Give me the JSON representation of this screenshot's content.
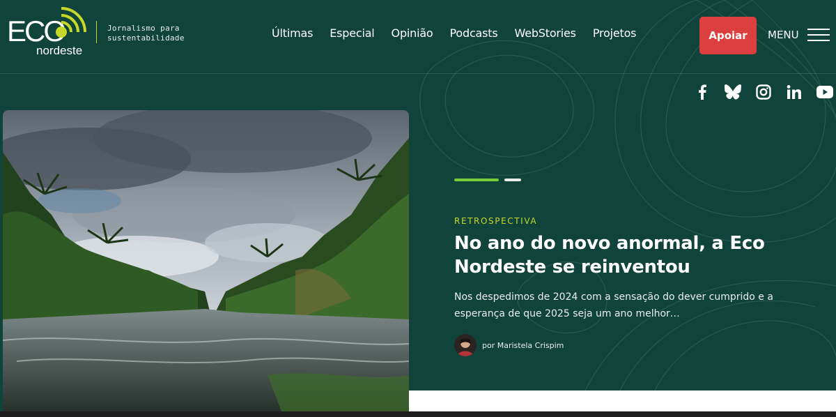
{
  "brand": {
    "logo_main": "ECO",
    "logo_sub": "nordeste",
    "tagline_line1": "Jornalismo para",
    "tagline_line2": "sustentabilidade",
    "accent_color": "#c8d82a",
    "background_color": "#10443a"
  },
  "nav": {
    "items": [
      "Últimas",
      "Especial",
      "Opinião",
      "Podcasts",
      "WebStories",
      "Projetos"
    ]
  },
  "header": {
    "support_label": "Apoiar",
    "support_color": "#dc3f3f",
    "menu_label": "MENU"
  },
  "social": [
    "facebook-icon",
    "bluesky-icon",
    "instagram-icon",
    "linkedin-icon",
    "youtube-icon"
  ],
  "hero": {
    "slider_active_color": "#78cc3a",
    "slider_total": 2,
    "slider_current": 1,
    "kicker": "RETROSPECTIVA",
    "headline": "No ano do novo anormal, a Eco Nordeste se reinventou",
    "excerpt": "Nos despedimos de 2024 com a sensação do dever cumprido e a esperança de que 2025 seja um ano melhor…",
    "byline": "por Maristela Crispim"
  }
}
